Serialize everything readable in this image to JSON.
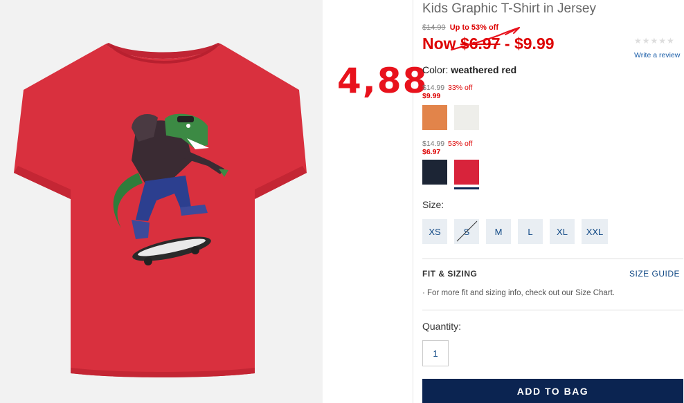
{
  "annotation": "4,88",
  "product": {
    "title": "Kids Graphic T-Shirt in Jersey",
    "original_price": "$14.99",
    "discount_label": "Up to 53% off",
    "now_prefix": "Now",
    "now_low": "$6.97",
    "now_separator": "-",
    "now_high": "$9.99",
    "rating_stars": "★★★★★",
    "review_link": "Write a review"
  },
  "color": {
    "label": "Color:",
    "selected": "weathered red",
    "tiers": [
      {
        "original": "$14.99",
        "discount": "33% off",
        "sale": "$9.99",
        "swatches": [
          {
            "name": "orange",
            "hex": "#e2844a"
          },
          {
            "name": "off-white",
            "hex": "#eeeeea"
          }
        ]
      },
      {
        "original": "$14.99",
        "discount": "53% off",
        "sale": "$6.97",
        "swatches": [
          {
            "name": "navy",
            "hex": "#1c2535"
          },
          {
            "name": "weathered red",
            "hex": "#d8233b"
          }
        ]
      }
    ]
  },
  "size": {
    "label": "Size:",
    "options": [
      "XS",
      "S",
      "M",
      "L",
      "XL",
      "XXL"
    ],
    "unavailable": [
      "S"
    ]
  },
  "fit": {
    "heading": "FIT & SIZING",
    "guide_link": "SIZE GUIDE",
    "info": "· For more fit and sizing info, check out our Size Chart."
  },
  "quantity": {
    "label": "Quantity:",
    "value": "1"
  },
  "add_to_bag": "ADD TO BAG",
  "colors": {
    "sale_red": "#dd0000",
    "navy": "#0b2451",
    "link_blue": "#124a86",
    "shirt_red": "#d9303e"
  }
}
